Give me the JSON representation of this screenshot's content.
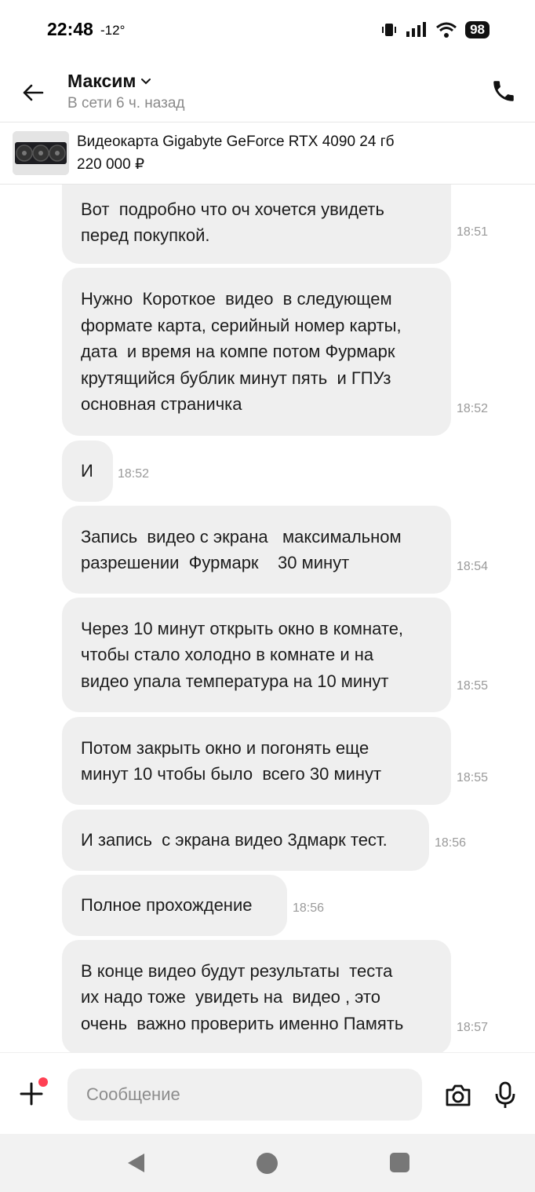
{
  "status_bar": {
    "time": "22:48",
    "temperature": "-12°",
    "battery": "98"
  },
  "header": {
    "contact_name": "Максим",
    "contact_status": "В сети 6 ч. назад"
  },
  "product": {
    "title": "Видеокарта Gigabyte GeForce RTX 4090 24 гб",
    "price": "220 000 ₽"
  },
  "messages": [
    {
      "text": "Вот  подробно что оч хочется увидеть\nперед покупкой.",
      "time": "18:51"
    },
    {
      "text": "Нужно  Короткое  видео  в следующем\nформате карта, серийный номер карты,\nдата  и время на компе потом Фурмарк\nкрутящийся бублик минут пять  и ГПУз\nосновная страничка",
      "time": "18:52"
    },
    {
      "text": "И",
      "time": "18:52"
    },
    {
      "text": "Запись  видео с экрана   максимальном\nразрешении  Фурмарк    30 минут",
      "time": "18:54"
    },
    {
      "text": "Через 10 минут открыть окно в комнате,\nчтобы стало холодно в комнате и на\nвидео упала температура на 10 минут",
      "time": "18:55"
    },
    {
      "text": "Потом закрыть окно и погонять еще\nминут 10 чтобы было  всего 30 минут",
      "time": "18:55"
    },
    {
      "text": "И запись  с экрана видео 3дмарк тест.",
      "time": "18:56"
    },
    {
      "text": "Полное прохождение",
      "time": "18:56"
    },
    {
      "text": "В конце видео будут результаты  теста\nих надо тоже  увидеть на  видео , это\nочень  важно проверить именно Память",
      "time": "18:57"
    }
  ],
  "composer": {
    "placeholder": "Сообщение"
  },
  "icons": {
    "back": "arrow-left-icon",
    "chevron": "chevron-down-icon",
    "call": "phone-icon",
    "attach": "plus-icon",
    "camera": "camera-icon",
    "mic": "microphone-icon"
  },
  "colors": {
    "bubble": "#efefef",
    "notification_dot": "#ff4053",
    "muted_text": "#8a8a8a"
  }
}
